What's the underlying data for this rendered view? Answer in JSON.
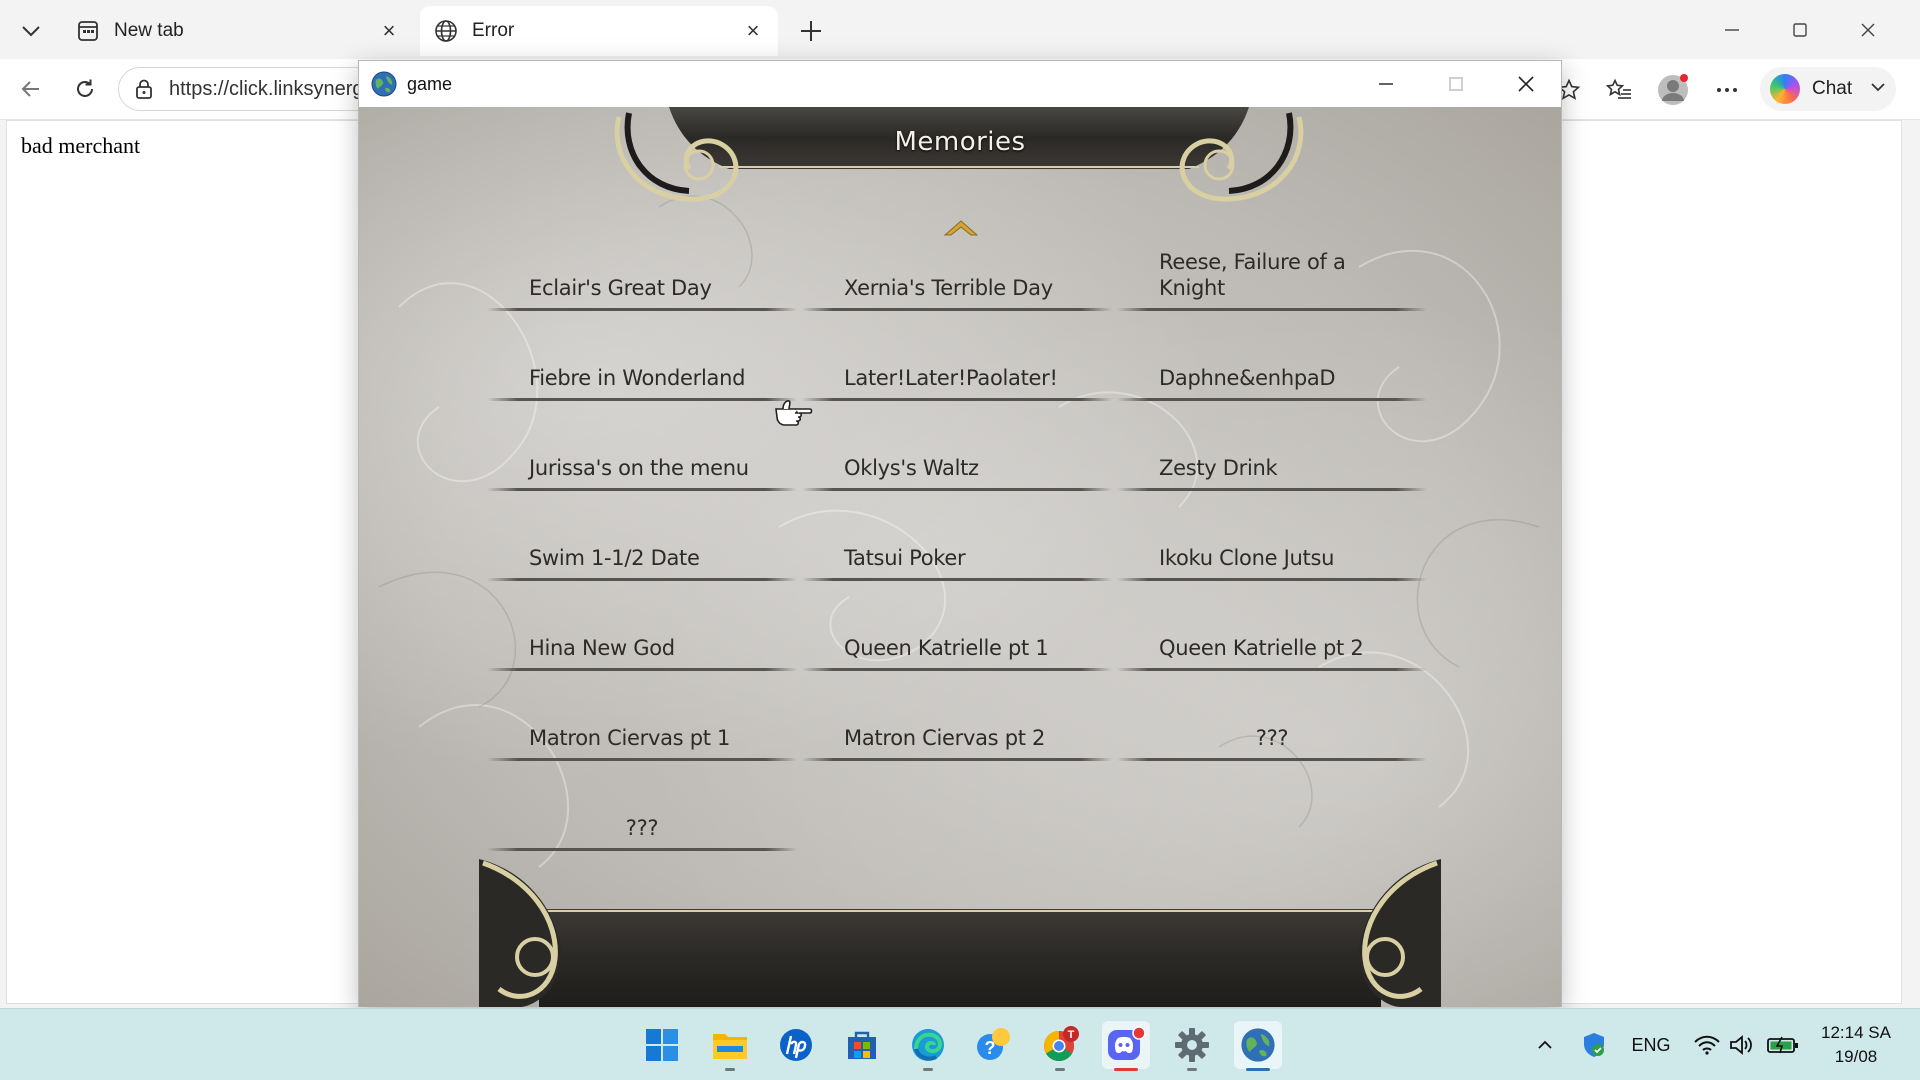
{
  "browser": {
    "tabs": [
      {
        "title": "New tab",
        "icon": "new-tab-page-icon"
      },
      {
        "title": "Error",
        "icon": "globe-icon",
        "active": true
      }
    ],
    "address": "https://click.linksynergy.com",
    "toolbar_icons": [
      "favorite-star-icon",
      "favorites-list-icon",
      "profile-avatar-icon",
      "more-options-icon"
    ],
    "chat_label": "Chat"
  },
  "page": {
    "text": "bad merchant"
  },
  "game_window": {
    "title": "game",
    "header_title": "Memories",
    "memories": [
      {
        "label": "Eclair's Great Day"
      },
      {
        "label": "Xernia's Terrible Day"
      },
      {
        "label": "Reese, Failure of a Knight"
      },
      {
        "label": "Fiebre in Wonderland"
      },
      {
        "label": "Later!Later!Paolater!"
      },
      {
        "label": "Daphne&enhpaD"
      },
      {
        "label": "Jurissa's on the menu"
      },
      {
        "label": "Oklys's Waltz"
      },
      {
        "label": "Zesty Drink"
      },
      {
        "label": "Swim 1-1/2 Date"
      },
      {
        "label": "Tatsui Poker"
      },
      {
        "label": "Ikoku Clone Jutsu"
      },
      {
        "label": "Hina New God"
      },
      {
        "label": "Queen Katrielle pt 1"
      },
      {
        "label": "Queen Katrielle pt 2"
      },
      {
        "label": "Matron Ciervas pt 1"
      },
      {
        "label": "Matron Ciervas pt 2"
      },
      {
        "label": "???"
      },
      {
        "label": "???"
      }
    ]
  },
  "taskbar": {
    "apps": [
      "start-icon",
      "file-explorer-icon",
      "hp-icon",
      "microsoft-store-icon",
      "edge-icon",
      "get-help-icon",
      "chrome-icon",
      "discord-icon",
      "settings-icon",
      "game-app-icon"
    ],
    "language": "ENG",
    "time": "12:14 SA",
    "date": "19/08",
    "chrome_badge": "T"
  },
  "colors": {
    "taskbar": "#cfe8ea",
    "parchment": "#bdbab5",
    "banner_dark": "#2b2926",
    "banner_gold": "#d8cfa2",
    "text_dark": "#2d2b28"
  }
}
